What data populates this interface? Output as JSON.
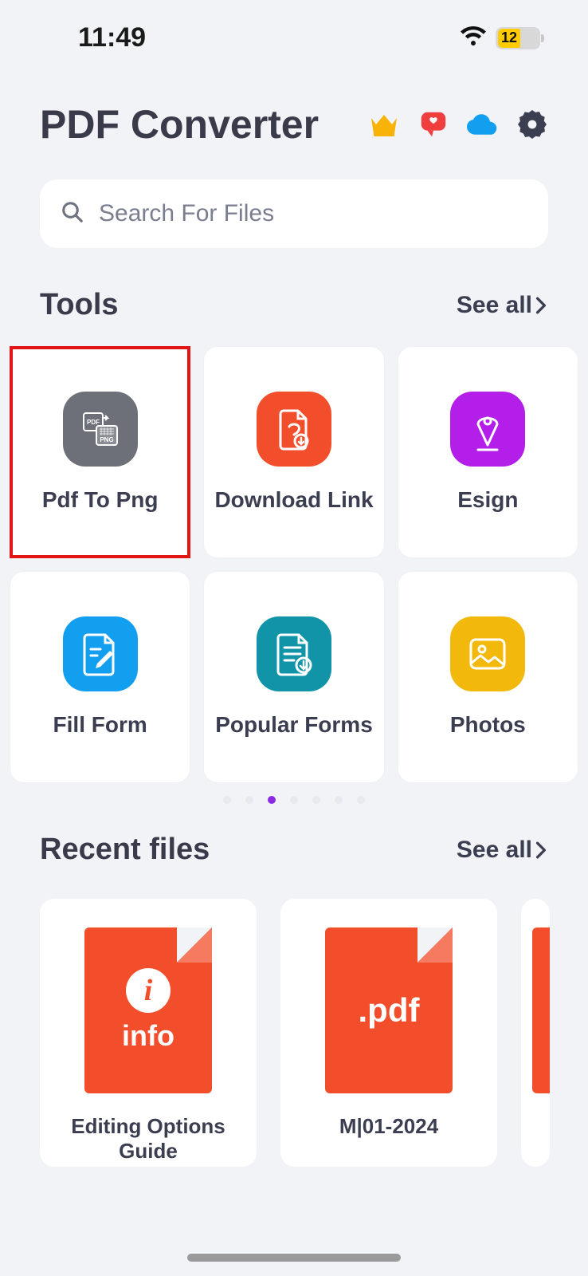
{
  "status": {
    "time": "11:49",
    "battery": "12"
  },
  "header": {
    "title": "PDF Converter"
  },
  "search": {
    "placeholder": "Search For Files"
  },
  "tools": {
    "title": "Tools",
    "see_all": "See all",
    "items": [
      {
        "label": "Pdf To Png",
        "icon": "pdf-to-png-icon",
        "color": "#6e7079"
      },
      {
        "label": "Download Link",
        "icon": "download-link-icon",
        "color": "#f24e2b"
      },
      {
        "label": "Esign",
        "icon": "esign-icon",
        "color": "#b31ee8"
      },
      {
        "label": "Fill Form",
        "icon": "fill-form-icon",
        "color": "#129ff0"
      },
      {
        "label": "Popular Forms",
        "icon": "popular-forms-icon",
        "color": "#1194a8"
      },
      {
        "label": "Photos",
        "icon": "photos-icon",
        "color": "#f2b80c"
      }
    ],
    "page_count": 7,
    "active_page_index": 2
  },
  "recent": {
    "title": "Recent files",
    "see_all": "See all",
    "files": [
      {
        "name": "Editing Options Guide",
        "badge_type": "info",
        "badge_text": "info"
      },
      {
        "name": "M|01-2024",
        "badge_type": "pdf",
        "badge_text": ".pdf"
      }
    ]
  }
}
